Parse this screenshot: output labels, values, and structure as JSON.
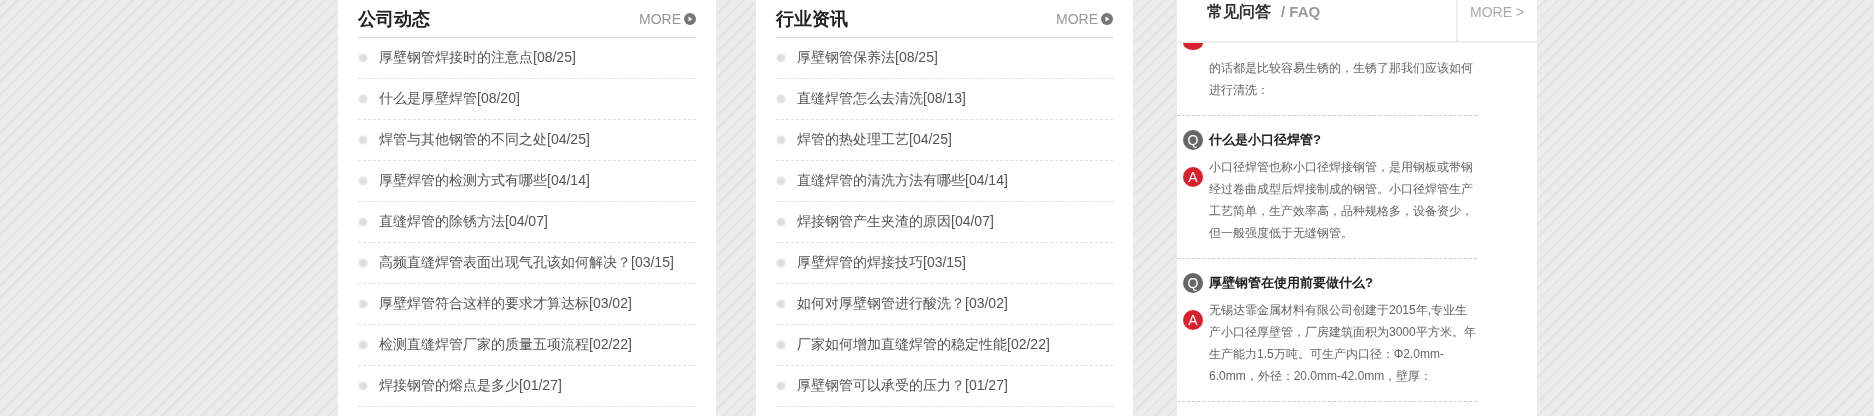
{
  "news_panels": [
    {
      "title": "公司动态",
      "more": "MORE",
      "items": [
        {
          "text": "厚壁钢管焊接时的注意点[08/25]"
        },
        {
          "text": "什么是厚壁焊管[08/20]"
        },
        {
          "text": "焊管与其他钢管的不同之处[04/25]"
        },
        {
          "text": "厚壁焊管的检测方式有哪些[04/14]"
        },
        {
          "text": "直缝焊管的除锈方法[04/07]"
        },
        {
          "text": "高频直缝焊管表面出现气孔该如何解决？[03/15]"
        },
        {
          "text": "厚壁焊管符合这样的要求才算达标[03/02]"
        },
        {
          "text": "检测直缝焊管厂家的质量五项流程[02/22]"
        },
        {
          "text": "焊接钢管的熔点是多少[01/27]"
        }
      ]
    },
    {
      "title": "行业资讯",
      "more": "MORE",
      "items": [
        {
          "text": "厚壁钢管保养法[08/25]"
        },
        {
          "text": "直缝焊管怎么去清洗[08/13]"
        },
        {
          "text": "焊管的热处理工艺[04/25]"
        },
        {
          "text": "直缝焊管的清洗方法有哪些[04/14]"
        },
        {
          "text": "焊接钢管产生夹渣的原因[04/07]"
        },
        {
          "text": "厚壁焊管的焊接技巧[03/15]"
        },
        {
          "text": "如何对厚壁钢管进行酸洗？[03/02]"
        },
        {
          "text": "厂家如何增加直缝焊管的稳定性能[02/22]"
        },
        {
          "text": "厚壁钢管可以承受的压力？[01/27]"
        }
      ]
    }
  ],
  "faq": {
    "title": "常见问答",
    "subtitle": "/ FAQ",
    "more": "MORE >",
    "items": [
      {
        "kind": "cut",
        "answer": "的话都是比较容易生锈的，生锈了那我们应该如何进行清洗："
      },
      {
        "kind": "full",
        "q_badge": "Q",
        "question": "什么是小口径焊管?",
        "a_badge": "A",
        "answer": "小口径焊管也称小口径焊接钢管，是用钢板或带钢经过卷曲成型后焊接制成的钢管。小口径焊管生产工艺简单，生产效率高，品种规格多，设备资少，但一般强度低于无缝钢管。"
      },
      {
        "kind": "full",
        "q_badge": "Q",
        "question": "厚壁钢管在使用前要做什么?",
        "a_badge": "A",
        "answer": "无锡达霏金属材料有限公司创建于2015年,专业生产小口径厚壁管，厂房建筑面积为3000平方米。年生产能力1.5万吨。可生产内口径：Φ2.0mm-6.0mm，外径：20.0mm-42.0mm，壁厚："
      }
    ]
  }
}
